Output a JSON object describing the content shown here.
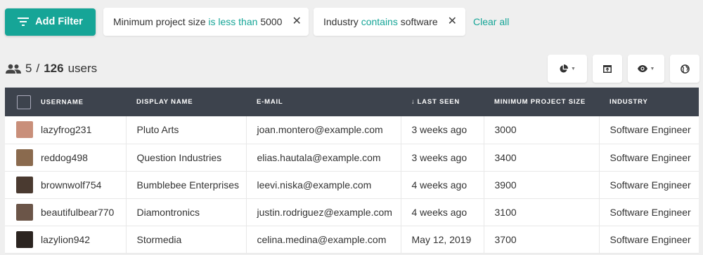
{
  "toolbar": {
    "add_filter_label": "Add Filter",
    "clear_all_label": "Clear all"
  },
  "filters": [
    {
      "field": "Minimum project size",
      "operator": "is less than",
      "value": "5000"
    },
    {
      "field": "Industry",
      "operator": "contains",
      "value": "software"
    }
  ],
  "summary": {
    "shown": "5",
    "separator": "/",
    "total": "126",
    "unit": "users"
  },
  "view_buttons": [
    "pie-chart-icon",
    "export-icon",
    "eye-icon",
    "globe-icon"
  ],
  "table": {
    "columns": [
      "USERNAME",
      "DISPLAY NAME",
      "E-MAIL",
      "LAST SEEN",
      "MINIMUM PROJECT SIZE",
      "INDUSTRY"
    ],
    "sort_indicator": "↓",
    "rows": [
      {
        "username": "lazyfrog231",
        "display_name": "Pluto Arts",
        "email": "joan.montero@example.com",
        "last_seen": "3 weeks ago",
        "min_project_size": "3000",
        "industry": "Software Engineer",
        "avatar_color": "#c98f7a"
      },
      {
        "username": "reddog498",
        "display_name": "Question Industries",
        "email": "elias.hautala@example.com",
        "last_seen": "3 weeks ago",
        "min_project_size": "3400",
        "industry": "Software Engineer",
        "avatar_color": "#8a6a4e"
      },
      {
        "username": "brownwolf754",
        "display_name": "Bumblebee Enterprises",
        "email": "leevi.niska@example.com",
        "last_seen": "4 weeks ago",
        "min_project_size": "3900",
        "industry": "Software Engineer",
        "avatar_color": "#4a3a30"
      },
      {
        "username": "beautifulbear770",
        "display_name": "Diamontronics",
        "email": "justin.rodriguez@example.com",
        "last_seen": "4 weeks ago",
        "min_project_size": "3100",
        "industry": "Software Engineer",
        "avatar_color": "#6b5548"
      },
      {
        "username": "lazylion942",
        "display_name": "Stormedia",
        "email": "celina.medina@example.com",
        "last_seen": "May 12, 2019",
        "min_project_size": "3700",
        "industry": "Software Engineer",
        "avatar_color": "#2b2420"
      }
    ]
  },
  "colors": {
    "accent": "#16a597",
    "header_bg": "#3d434d",
    "page_bg": "#efefef"
  }
}
